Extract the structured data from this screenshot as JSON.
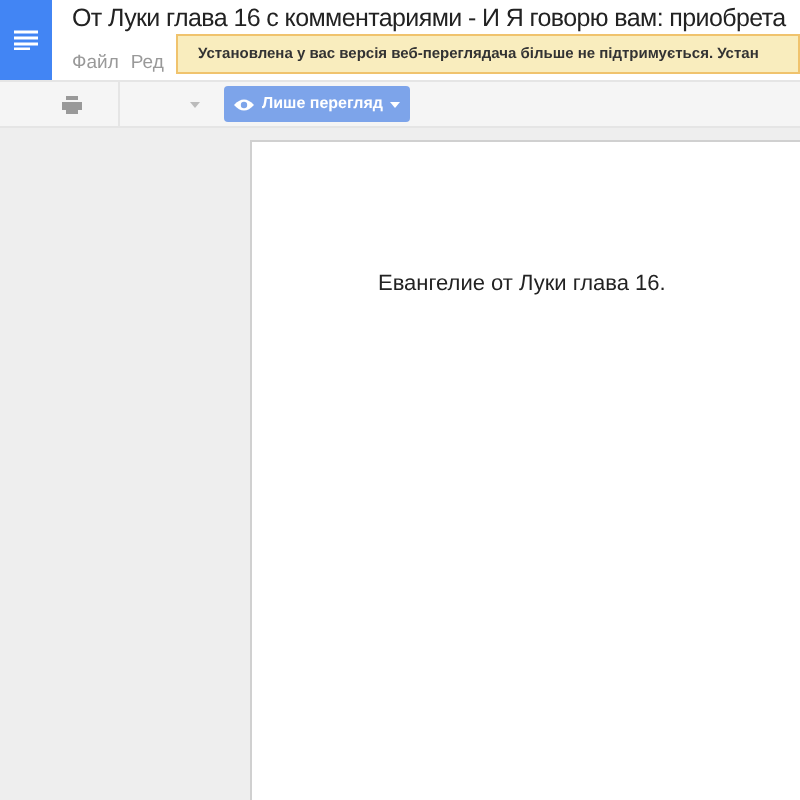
{
  "title": "От Луки глава 16 с комментариями - И Я говорю вам: приобрета",
  "menu": [
    "Файл",
    "Ред"
  ],
  "notice": "Установлена у вас версія веб-переглядача більше не підтримується. Устан",
  "toolbar": {
    "mode_button": "Лише перегляд"
  },
  "document": {
    "paragraphs": [
      "Евангелие от Луки глава 16."
    ]
  }
}
